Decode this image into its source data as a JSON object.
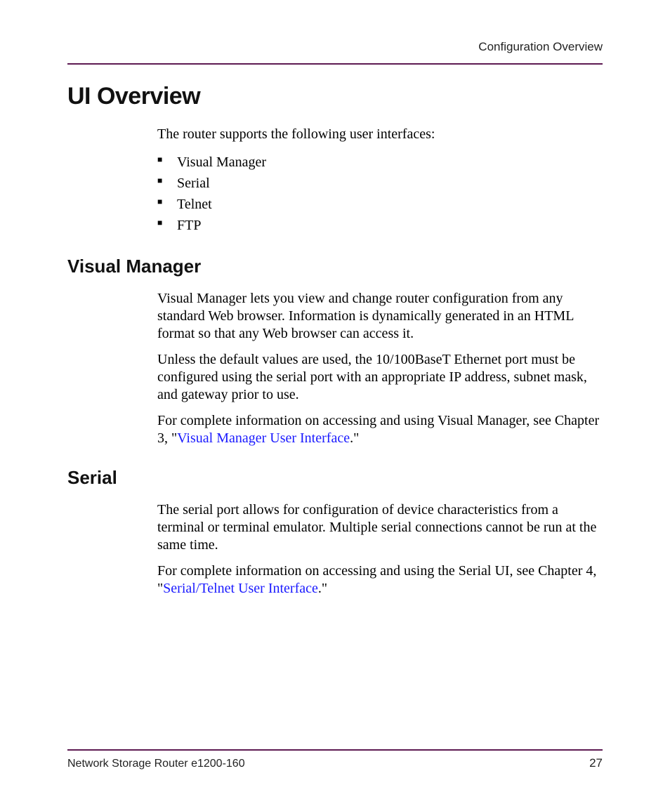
{
  "header": {
    "section": "Configuration Overview"
  },
  "footer": {
    "doc_title": "Network Storage Router e1200-160",
    "page_number": "27"
  },
  "h1": "UI Overview",
  "intro": "The router supports the following user interfaces:",
  "interfaces": [
    "Visual Manager",
    "Serial",
    "Telnet",
    "FTP"
  ],
  "vm": {
    "heading": "Visual Manager",
    "p1": "Visual Manager lets you view and change router configuration from any standard Web browser. Information is dynamically generated in an HTML format so that any Web browser can access it.",
    "p2": "Unless the default values are used, the 10/100BaseT Ethernet port must be configured using the serial port with an appropriate IP address, subnet mask, and gateway prior to use.",
    "p3_pre": "For complete information on accessing and using Visual Manager, see Chapter 3, \"",
    "p3_link": "Visual Manager User Interface",
    "p3_post": ".\""
  },
  "serial": {
    "heading": "Serial",
    "p1": "The serial port allows for configuration of device characteristics from a terminal or terminal emulator. Multiple serial connections cannot be run at the same time.",
    "p2_pre": "For complete information on accessing and using the Serial UI, see Chapter 4, \"",
    "p2_link": "Serial/Telnet User Interface",
    "p2_post": ".\""
  }
}
